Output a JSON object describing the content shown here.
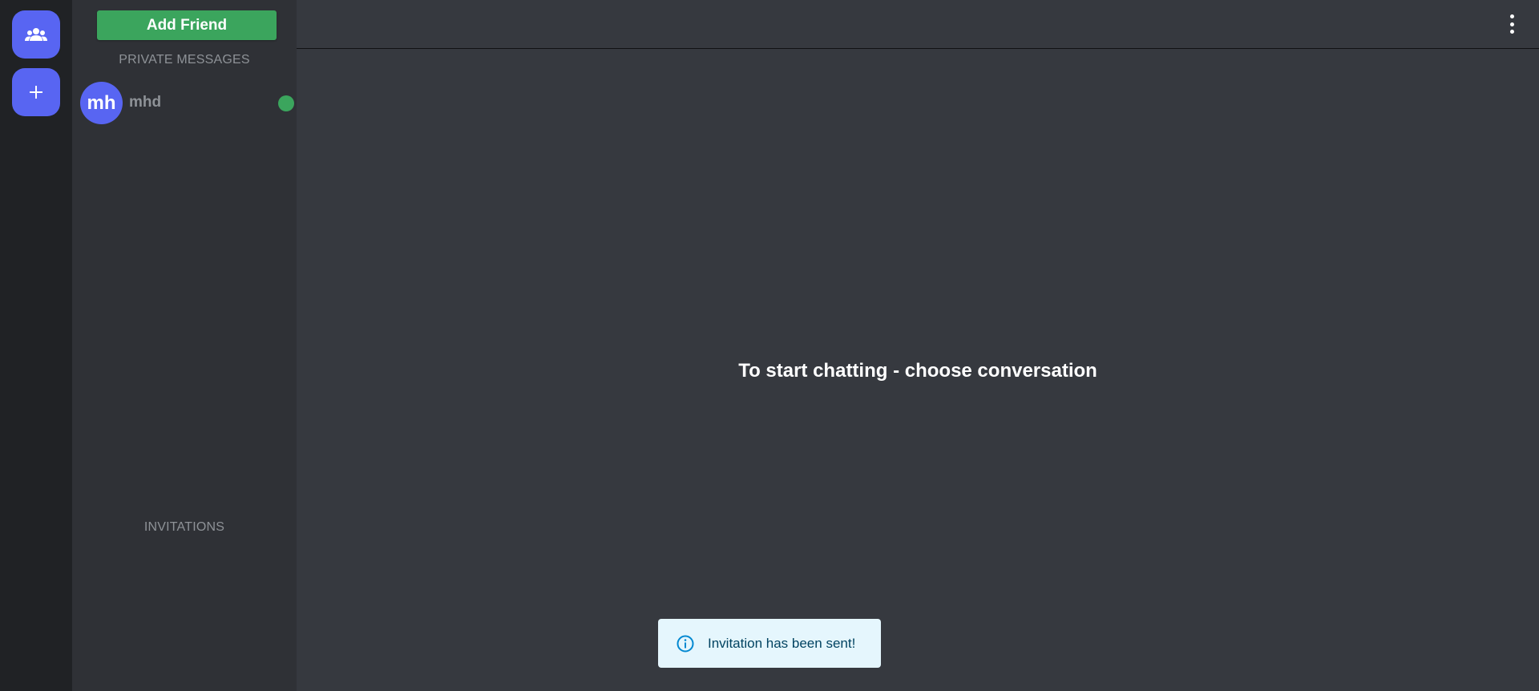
{
  "rail": {
    "friends_icon": "group-icon",
    "add_icon": "plus-icon"
  },
  "sidebar": {
    "add_friend_label": "Add Friend",
    "private_messages_title": "PRIVATE MESSAGES",
    "dm_list": [
      {
        "avatar_text": "mh",
        "name": "mhd",
        "status": "online",
        "status_color": "#3ba55d"
      }
    ],
    "invitations_title": "INVITATIONS"
  },
  "main": {
    "menu_icon": "more-vertical-icon",
    "empty_message": "To start chatting - choose conversation"
  },
  "toast": {
    "icon": "info-icon",
    "message": "Invitation has been sent!"
  },
  "colors": {
    "accent": "#5865f2",
    "success": "#3ba55d",
    "toast_bg": "#e5f6fd",
    "toast_text": "#014361"
  }
}
